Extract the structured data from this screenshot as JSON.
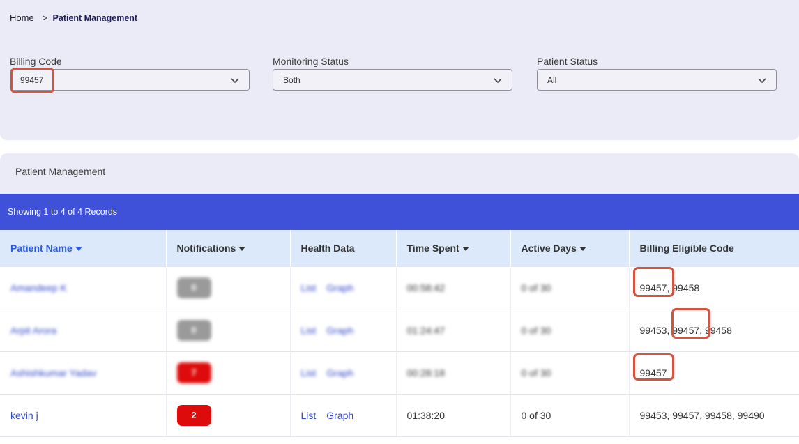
{
  "breadcrumb": {
    "home": "Home",
    "separator": ">",
    "current": "Patient Management"
  },
  "filters": {
    "billing_code": {
      "label": "Billing Code",
      "value": "99457"
    },
    "monitoring_status": {
      "label": "Monitoring Status",
      "value": "Both"
    },
    "patient_status": {
      "label": "Patient Status",
      "value": "All"
    }
  },
  "card": {
    "title": "Patient Management"
  },
  "records": {
    "summary": "Showing 1 to 4 of 4 Records"
  },
  "table": {
    "columns": [
      "Patient Name",
      "Notifications",
      "Health Data",
      "Time Spent",
      "Active Days",
      "Billing Eligible Code"
    ],
    "health_links": {
      "list": "List",
      "graph": "Graph"
    },
    "rows": [
      {
        "name": "Amandeep K",
        "notifications": "0",
        "time_spent": "00:58:42",
        "active_days": "0 of 30",
        "codes_a": "99457",
        "codes_b": ", 99458"
      },
      {
        "name": "Arpit Arora",
        "notifications": "0",
        "time_spent": "01:24:47",
        "active_days": "0 of 30",
        "codes_a": "99453,",
        "codes_b": "99457,",
        "codes_c": "99458"
      },
      {
        "name": "Ashishkumar Yadav",
        "notifications": "7",
        "time_spent": "00:28:18",
        "active_days": "0 of 30",
        "codes_a": "99457"
      },
      {
        "name": "kevin j",
        "notifications": "2",
        "time_spent": "01:38:20",
        "active_days": "0 of 30",
        "codes_a": "99453, 99457, 99458, 99490"
      }
    ]
  },
  "colors": {
    "highlight": "#d6533f",
    "header_bar": "#3f51d9",
    "badge_alert": "#dd0b0b",
    "badge_zero": "#9a9a9a",
    "link": "#3347c9"
  },
  "icons": {
    "dropdown": "chevron-down-icon",
    "sort": "caret-down-icon"
  }
}
